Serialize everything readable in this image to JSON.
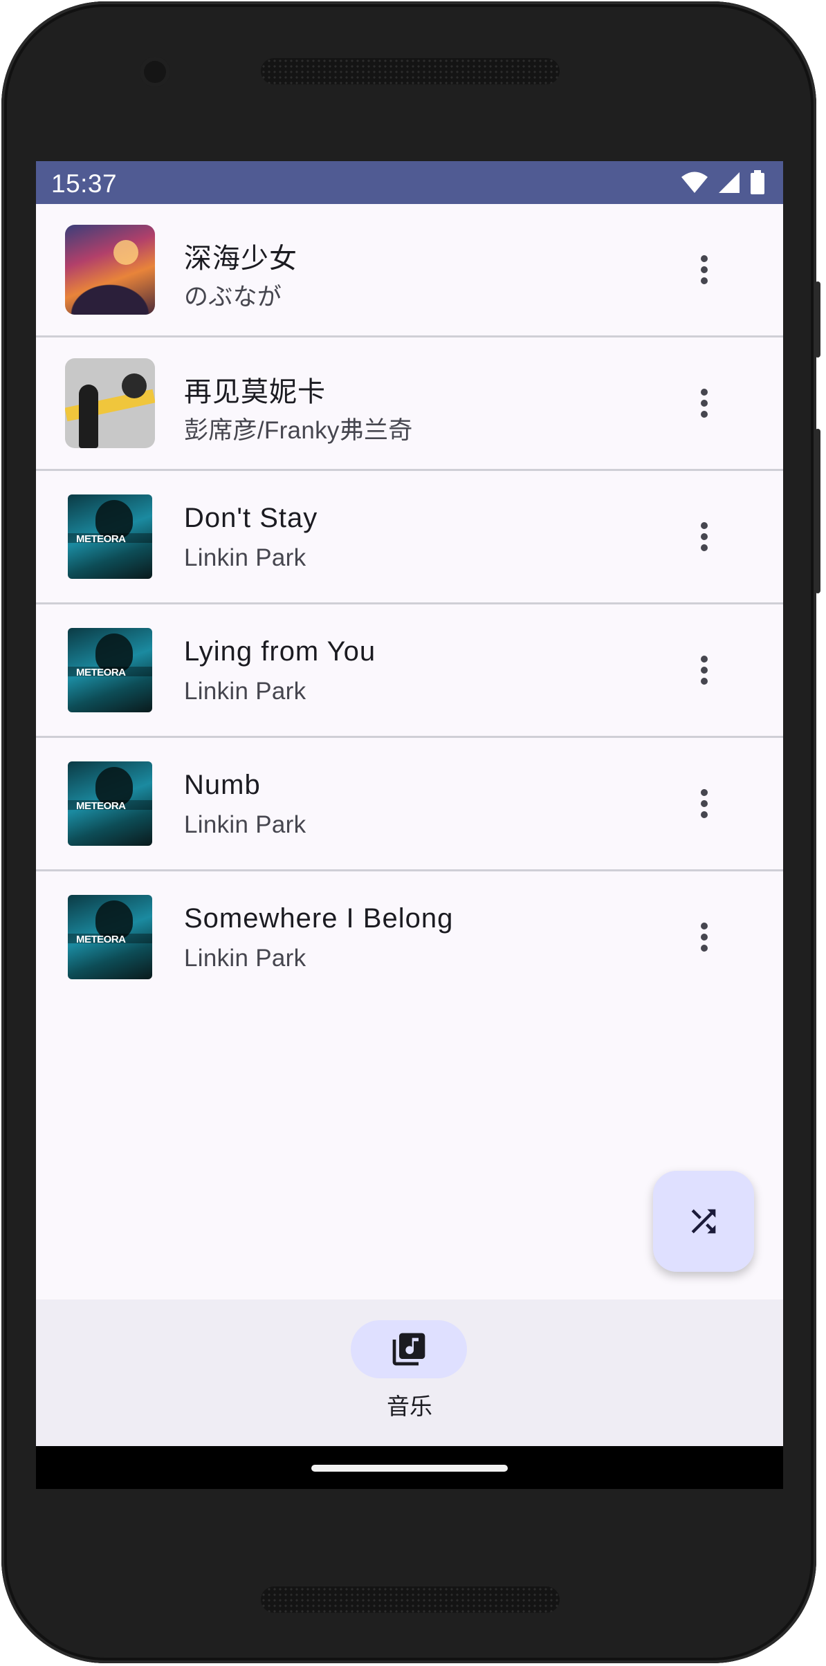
{
  "status_bar": {
    "time": "15:37",
    "icons": [
      "wifi-icon",
      "cell-signal-icon",
      "battery-icon"
    ]
  },
  "songs": [
    {
      "title": "深海少女",
      "artist": "のぶなが",
      "art": "sunset-album-art"
    },
    {
      "title": "再见莫妮卡",
      "artist": "彭席彦/Franky弗兰奇",
      "art": "grey-album-art"
    },
    {
      "title": "Don't Stay",
      "artist": "Linkin Park",
      "art": "meteora-album-art"
    },
    {
      "title": "Lying from You",
      "artist": "Linkin Park",
      "art": "meteora-album-art"
    },
    {
      "title": "Numb",
      "artist": "Linkin Park",
      "art": "meteora-album-art"
    },
    {
      "title": "Somewhere I Belong",
      "artist": "Linkin Park",
      "art": "meteora-album-art"
    }
  ],
  "album_art_text": {
    "meteora_logo": "METEORA"
  },
  "fab": {
    "icon": "shuffle-icon"
  },
  "bottom_nav": {
    "items": [
      {
        "label": "音乐",
        "icon": "music-library-icon",
        "selected": true
      }
    ]
  },
  "colors": {
    "status_bar": "#505b93",
    "background": "#fbf8fd",
    "accent_container": "#dfe0ff",
    "nav_background": "#efedf4"
  }
}
